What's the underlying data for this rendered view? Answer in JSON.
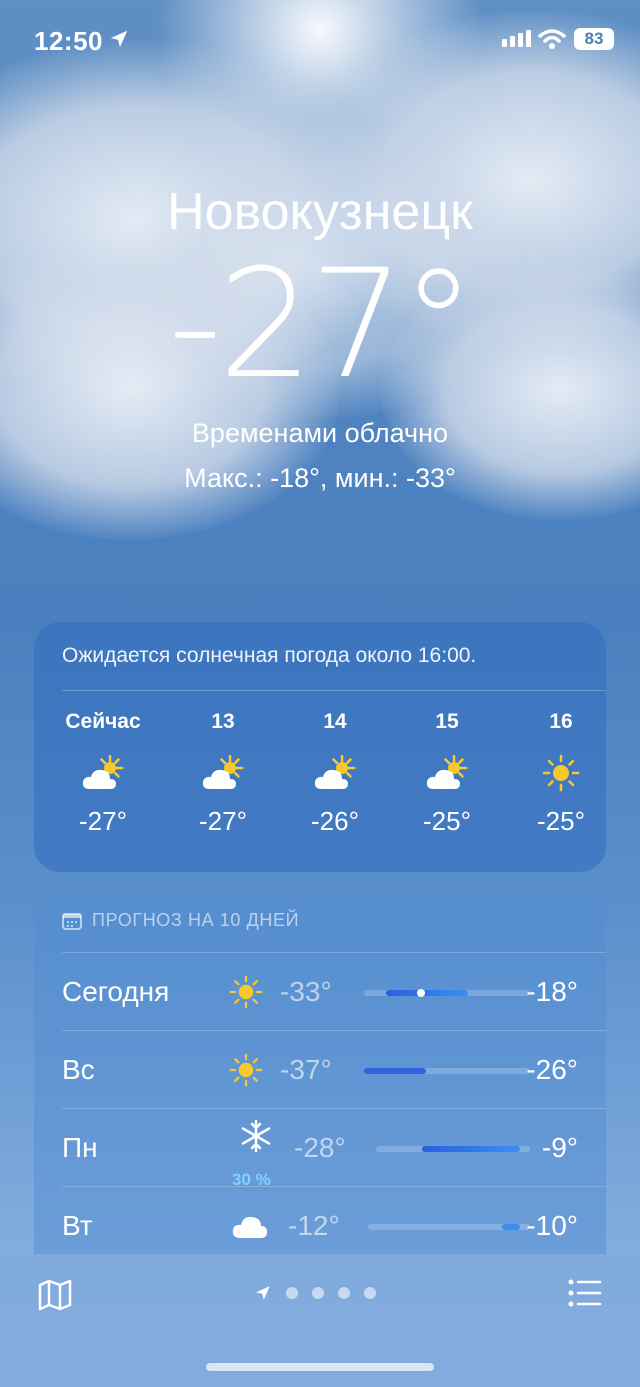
{
  "status_bar": {
    "time": "12:50",
    "battery": "83"
  },
  "location": {
    "city": "Новокузнецк",
    "temperature": "-27°",
    "condition": "Временами облачно",
    "hi_lo": "Макс.: -18°, мин.: -33°"
  },
  "hourly": {
    "message": "Ожидается солнечная погода около 16:00.",
    "items": [
      {
        "label": "Сейчас",
        "icon": "partly-sunny-icon",
        "temp": "-27°"
      },
      {
        "label": "13",
        "icon": "partly-sunny-icon",
        "temp": "-27°"
      },
      {
        "label": "14",
        "icon": "partly-sunny-icon",
        "temp": "-26°"
      },
      {
        "label": "15",
        "icon": "partly-sunny-icon",
        "temp": "-25°"
      },
      {
        "label": "16",
        "icon": "sun-icon",
        "temp": "-25°"
      }
    ]
  },
  "forecast": {
    "header": "ПРОГНОЗ НА 10 ДНЕЙ",
    "days": [
      {
        "day": "Сегодня",
        "icon": "sun-icon",
        "low": "-33°",
        "high": "-18°",
        "precip": ""
      },
      {
        "day": "Вс",
        "icon": "sun-icon",
        "low": "-37°",
        "high": "-26°",
        "precip": ""
      },
      {
        "day": "Пн",
        "icon": "snowflake-icon",
        "low": "-28°",
        "high": "-9°",
        "precip": "30 %"
      },
      {
        "day": "Вт",
        "icon": "cloud-icon",
        "low": "-12°",
        "high": "-10°",
        "precip": ""
      }
    ]
  },
  "pager": {
    "total": 5,
    "current": 0
  }
}
